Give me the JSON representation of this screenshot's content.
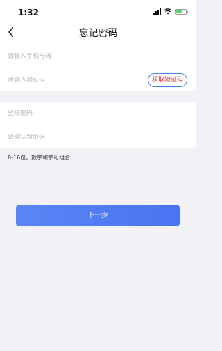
{
  "status_bar": {
    "time": "1:32",
    "battery_level": 0.7,
    "battery_color": "#4cd964"
  },
  "nav": {
    "back_icon": "chevron-left-icon",
    "title": "忘记密码"
  },
  "form": {
    "phone_placeholder": "请输入手机号码",
    "code_placeholder": "请输入验证码",
    "get_code_label": "获取验证码",
    "password_placeholder": "登陆密码",
    "confirm_placeholder": "请确认新密码",
    "password_hint": "8-16位，数字和字母组合"
  },
  "actions": {
    "next_label": "下一步",
    "accent": "#4a72f2"
  }
}
